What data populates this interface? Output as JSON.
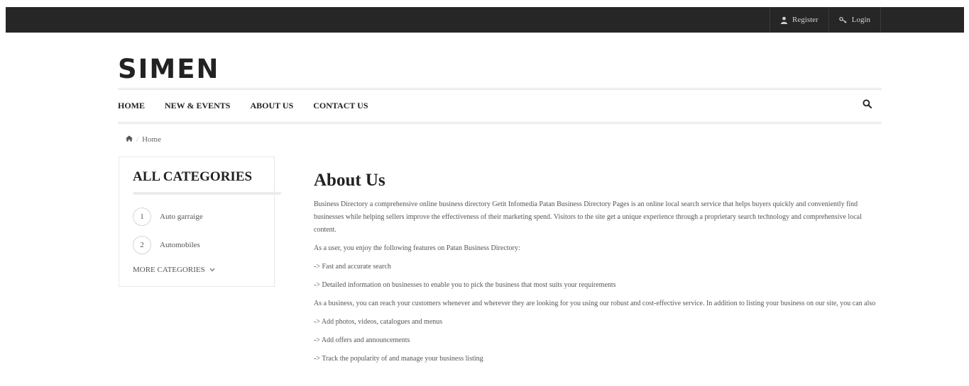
{
  "topbar": {
    "register_label": "Register",
    "login_label": "Login"
  },
  "logo": {
    "text": "SIMEN"
  },
  "nav": {
    "items": [
      "HOME",
      "NEW & EVENTS",
      "ABOUT US",
      "CONTACT US"
    ]
  },
  "breadcrumb": {
    "home_label": "Home"
  },
  "sidebar": {
    "title": "ALL CATEGORIES",
    "categories": [
      {
        "num": "1",
        "label": "Auto garraige"
      },
      {
        "num": "2",
        "label": "Automobiles"
      }
    ],
    "more_label": "MORE CATEGORIES"
  },
  "main": {
    "title": "About Us",
    "paragraphs": [
      "Business Directory a comprehensive online business directory Getit Infomedia Patan Business Directory Pages is an online local search service that helps buyers quickly and conveniently find businesses while helping sellers improve the effectiveness of their marketing spend. Visitors to the site get a unique experience through a proprietary search technology and comprehensive local content.",
      "As a user, you enjoy the following features on Patan Business Directory:",
      "-> Fast and accurate search",
      "-> Detailed information on businesses to enable you to pick the business that most suits your requirements",
      "As a business, you can reach your customers whenever and wherever they are looking for you using our robust and cost-effective service. In addition to listing your business on our site, you can also",
      "-> Add photos, videos, catalogues and menus",
      "-> Add offers and announcements",
      "-> Track the popularity of and manage your business listing"
    ]
  },
  "colors": {
    "topbar_bg": "#262626",
    "text_dark": "#222222",
    "text_muted": "#555555"
  }
}
